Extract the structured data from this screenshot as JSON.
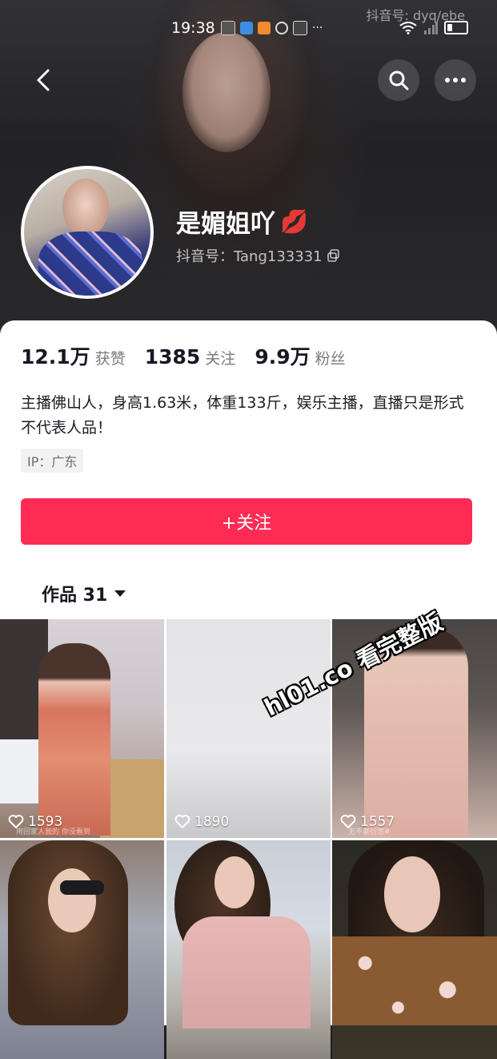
{
  "status_bar": {
    "time": "19:38",
    "top_watermark": "抖音号: dyq/ebe"
  },
  "profile": {
    "nickname": "是媚姐吖",
    "nickname_emoji": "💋",
    "douyin_id": "抖音号：Tang133331",
    "stats": [
      {
        "value": "12.1万",
        "label": "获赞"
      },
      {
        "value": "1385",
        "label": "关注"
      },
      {
        "value": "9.9万",
        "label": "粉丝"
      }
    ],
    "bio": "主播佛山人，身高1.63米，体重133斤，娱乐主播，直播只是形式不代表人品！",
    "ip_location": "IP：广东",
    "follow_button": "+关注",
    "works_tab": "作品 31"
  },
  "videos": [
    {
      "likes": "1593",
      "caption": "用回家人我的 你没看到"
    },
    {
      "likes": "1890"
    },
    {
      "likes": "1557",
      "caption": "无不衰衍怎#"
    },
    {},
    {},
    {}
  ],
  "overlay_watermark": "hl01.co 看完整版",
  "colors": {
    "accent": "#fe2c55",
    "text_primary": "#161823",
    "text_secondary": "#7a7b80"
  }
}
